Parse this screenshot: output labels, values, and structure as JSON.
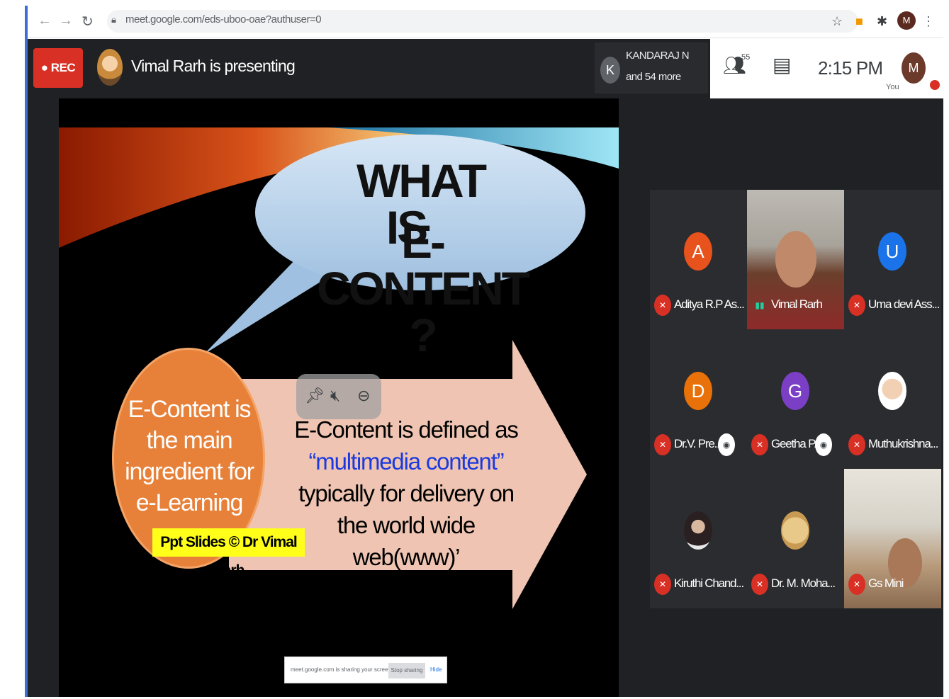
{
  "browser": {
    "url": "meet.google.com/eds-uboo-oae?authuser=0",
    "profile_initial": "M"
  },
  "meet": {
    "rec_label": "REC",
    "presenting": "Vimal Rarh is presenting",
    "join": {
      "initial": "K",
      "name": "KANDARAJ N",
      "more": "and 54 more"
    },
    "people_count": "55",
    "time": "2:15 PM",
    "self": {
      "initial": "M",
      "label": "You"
    }
  },
  "slide": {
    "title_line1": "WHAT IS",
    "title_line2": "E-CONTENT ?",
    "circle_text": "E-Content is the main ingredient for e-Learning",
    "credit": "Ppt Slides © Dr Vimal Rarh",
    "def_line1": "E-Content is defined as",
    "def_line2": "“multimedia content”",
    "def_line3": "typically for delivery on the world wide web(www)’"
  },
  "share_bar": {
    "text": "meet.google.com is sharing your screen.",
    "stop": "Stop sharing",
    "hide": "Hide"
  },
  "participants": [
    {
      "name": "Aditya R.P As...",
      "initial": "A",
      "color": "#e8521c",
      "type": "avatar"
    },
    {
      "name": "Vimal Rarh",
      "type": "video"
    },
    {
      "name": "Uma devi Ass...",
      "initial": "U",
      "color": "#1a73e8",
      "type": "avatar"
    },
    {
      "name": "Dr.V. Pre...",
      "initial": "D",
      "color": "#e8710a",
      "type": "avatar"
    },
    {
      "name": "Geetha P...",
      "initial": "G",
      "color": "#7b3fc6",
      "type": "avatar"
    },
    {
      "name": "Muthukrishna...",
      "type": "photo"
    },
    {
      "name": "Kiruthi Chand...",
      "type": "photo"
    },
    {
      "name": "Dr. M. Moha...",
      "type": "photo"
    },
    {
      "name": "Gs Mini",
      "type": "video"
    }
  ]
}
